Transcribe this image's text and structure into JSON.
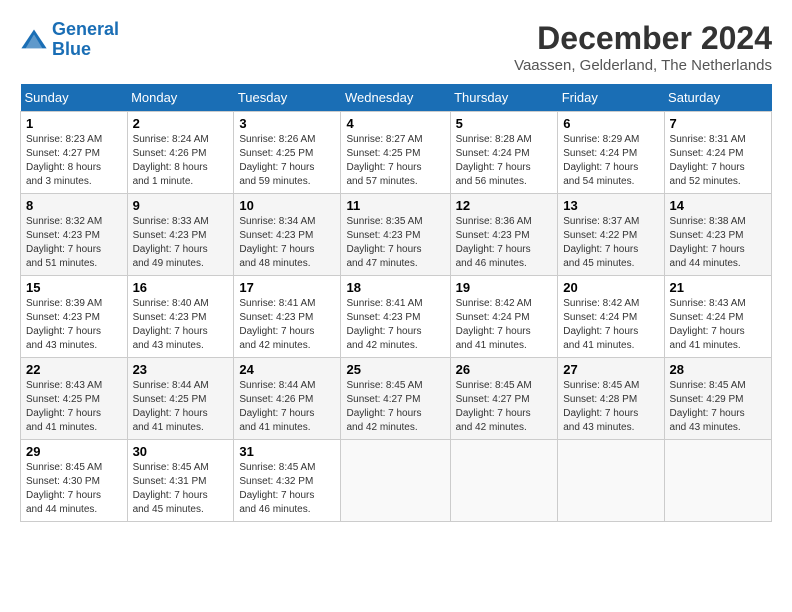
{
  "header": {
    "logo": {
      "line1": "General",
      "line2": "Blue"
    },
    "title": "December 2024",
    "location": "Vaassen, Gelderland, The Netherlands"
  },
  "columns": [
    "Sunday",
    "Monday",
    "Tuesday",
    "Wednesday",
    "Thursday",
    "Friday",
    "Saturday"
  ],
  "weeks": [
    [
      {
        "day": "1",
        "info": "Sunrise: 8:23 AM\nSunset: 4:27 PM\nDaylight: 8 hours\nand 3 minutes."
      },
      {
        "day": "2",
        "info": "Sunrise: 8:24 AM\nSunset: 4:26 PM\nDaylight: 8 hours\nand 1 minute."
      },
      {
        "day": "3",
        "info": "Sunrise: 8:26 AM\nSunset: 4:25 PM\nDaylight: 7 hours\nand 59 minutes."
      },
      {
        "day": "4",
        "info": "Sunrise: 8:27 AM\nSunset: 4:25 PM\nDaylight: 7 hours\nand 57 minutes."
      },
      {
        "day": "5",
        "info": "Sunrise: 8:28 AM\nSunset: 4:24 PM\nDaylight: 7 hours\nand 56 minutes."
      },
      {
        "day": "6",
        "info": "Sunrise: 8:29 AM\nSunset: 4:24 PM\nDaylight: 7 hours\nand 54 minutes."
      },
      {
        "day": "7",
        "info": "Sunrise: 8:31 AM\nSunset: 4:24 PM\nDaylight: 7 hours\nand 52 minutes."
      }
    ],
    [
      {
        "day": "8",
        "info": "Sunrise: 8:32 AM\nSunset: 4:23 PM\nDaylight: 7 hours\nand 51 minutes."
      },
      {
        "day": "9",
        "info": "Sunrise: 8:33 AM\nSunset: 4:23 PM\nDaylight: 7 hours\nand 49 minutes."
      },
      {
        "day": "10",
        "info": "Sunrise: 8:34 AM\nSunset: 4:23 PM\nDaylight: 7 hours\nand 48 minutes."
      },
      {
        "day": "11",
        "info": "Sunrise: 8:35 AM\nSunset: 4:23 PM\nDaylight: 7 hours\nand 47 minutes."
      },
      {
        "day": "12",
        "info": "Sunrise: 8:36 AM\nSunset: 4:23 PM\nDaylight: 7 hours\nand 46 minutes."
      },
      {
        "day": "13",
        "info": "Sunrise: 8:37 AM\nSunset: 4:22 PM\nDaylight: 7 hours\nand 45 minutes."
      },
      {
        "day": "14",
        "info": "Sunrise: 8:38 AM\nSunset: 4:23 PM\nDaylight: 7 hours\nand 44 minutes."
      }
    ],
    [
      {
        "day": "15",
        "info": "Sunrise: 8:39 AM\nSunset: 4:23 PM\nDaylight: 7 hours\nand 43 minutes."
      },
      {
        "day": "16",
        "info": "Sunrise: 8:40 AM\nSunset: 4:23 PM\nDaylight: 7 hours\nand 43 minutes."
      },
      {
        "day": "17",
        "info": "Sunrise: 8:41 AM\nSunset: 4:23 PM\nDaylight: 7 hours\nand 42 minutes."
      },
      {
        "day": "18",
        "info": "Sunrise: 8:41 AM\nSunset: 4:23 PM\nDaylight: 7 hours\nand 42 minutes."
      },
      {
        "day": "19",
        "info": "Sunrise: 8:42 AM\nSunset: 4:24 PM\nDaylight: 7 hours\nand 41 minutes."
      },
      {
        "day": "20",
        "info": "Sunrise: 8:42 AM\nSunset: 4:24 PM\nDaylight: 7 hours\nand 41 minutes."
      },
      {
        "day": "21",
        "info": "Sunrise: 8:43 AM\nSunset: 4:24 PM\nDaylight: 7 hours\nand 41 minutes."
      }
    ],
    [
      {
        "day": "22",
        "info": "Sunrise: 8:43 AM\nSunset: 4:25 PM\nDaylight: 7 hours\nand 41 minutes."
      },
      {
        "day": "23",
        "info": "Sunrise: 8:44 AM\nSunset: 4:25 PM\nDaylight: 7 hours\nand 41 minutes."
      },
      {
        "day": "24",
        "info": "Sunrise: 8:44 AM\nSunset: 4:26 PM\nDaylight: 7 hours\nand 41 minutes."
      },
      {
        "day": "25",
        "info": "Sunrise: 8:45 AM\nSunset: 4:27 PM\nDaylight: 7 hours\nand 42 minutes."
      },
      {
        "day": "26",
        "info": "Sunrise: 8:45 AM\nSunset: 4:27 PM\nDaylight: 7 hours\nand 42 minutes."
      },
      {
        "day": "27",
        "info": "Sunrise: 8:45 AM\nSunset: 4:28 PM\nDaylight: 7 hours\nand 43 minutes."
      },
      {
        "day": "28",
        "info": "Sunrise: 8:45 AM\nSunset: 4:29 PM\nDaylight: 7 hours\nand 43 minutes."
      }
    ],
    [
      {
        "day": "29",
        "info": "Sunrise: 8:45 AM\nSunset: 4:30 PM\nDaylight: 7 hours\nand 44 minutes."
      },
      {
        "day": "30",
        "info": "Sunrise: 8:45 AM\nSunset: 4:31 PM\nDaylight: 7 hours\nand 45 minutes."
      },
      {
        "day": "31",
        "info": "Sunrise: 8:45 AM\nSunset: 4:32 PM\nDaylight: 7 hours\nand 46 minutes."
      },
      null,
      null,
      null,
      null
    ]
  ]
}
